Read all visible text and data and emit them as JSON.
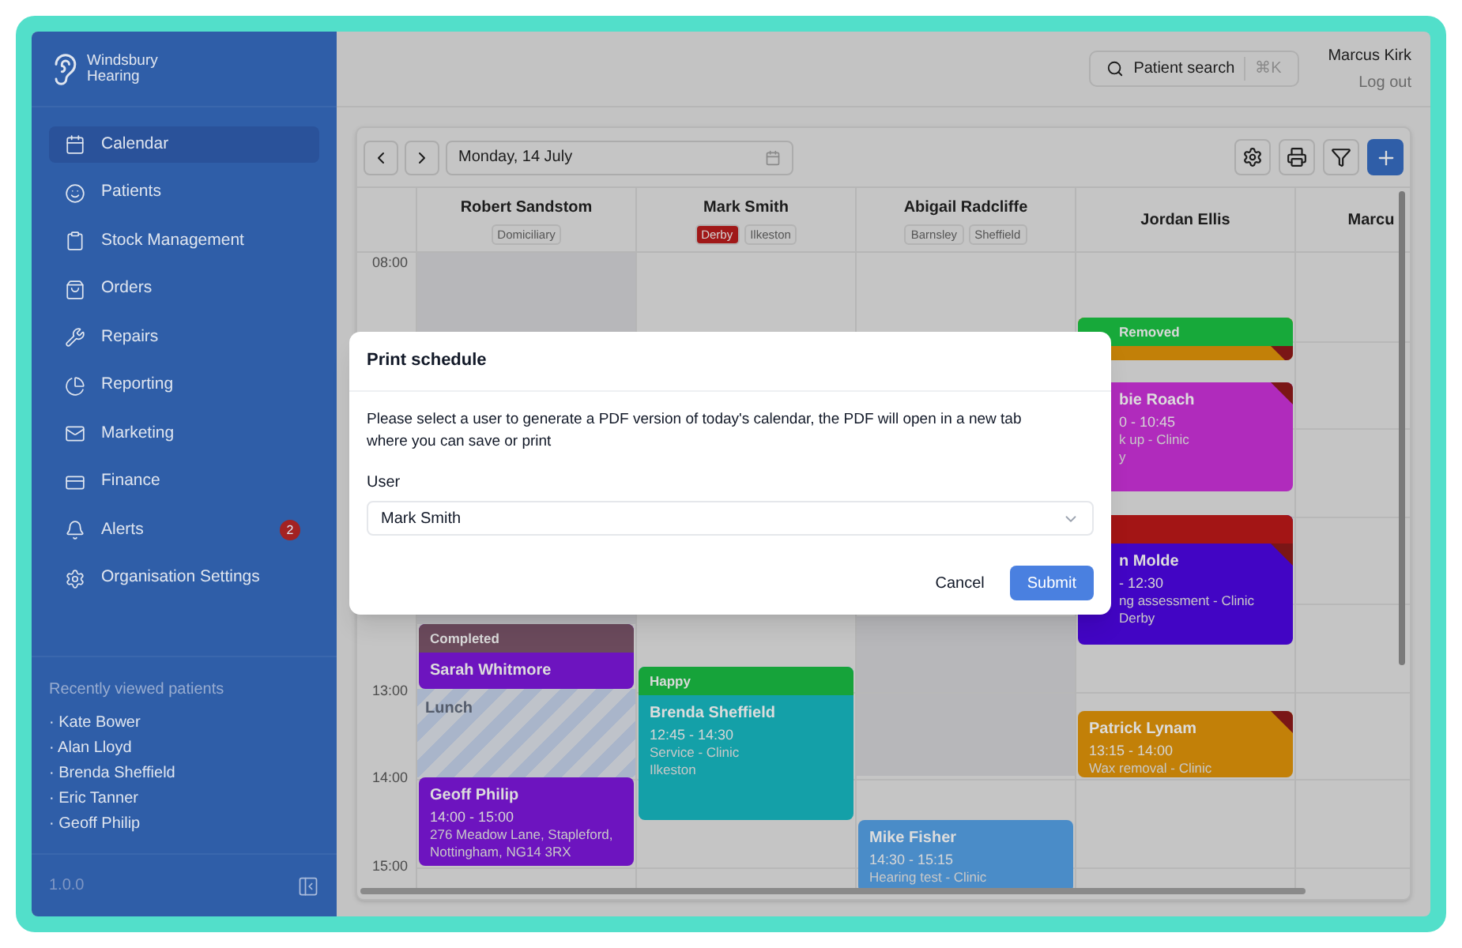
{
  "brand": {
    "name": "Windsbury Hearing"
  },
  "sidebar": {
    "items": [
      {
        "label": "Calendar",
        "selected": true
      },
      {
        "label": "Patients",
        "selected": false
      },
      {
        "label": "Stock Management",
        "selected": false
      },
      {
        "label": "Orders",
        "selected": false
      },
      {
        "label": "Repairs",
        "selected": false
      },
      {
        "label": "Reporting",
        "selected": false
      },
      {
        "label": "Marketing",
        "selected": false
      },
      {
        "label": "Finance",
        "selected": false
      },
      {
        "label": "Alerts",
        "selected": false,
        "badge": "2"
      },
      {
        "label": "Organisation Settings",
        "selected": false
      }
    ],
    "recent": {
      "title": "Recently viewed patients",
      "items": [
        "· Kate Bower",
        "· Alan Lloyd",
        "· Brenda Sheffield",
        "· Eric Tanner",
        "· Geoff Philip"
      ]
    },
    "version": "1.0.0"
  },
  "header": {
    "search": {
      "label": "Patient search",
      "shortcut": "⌘K"
    },
    "user": {
      "name": "Marcus Kirk",
      "logout": "Log out"
    }
  },
  "calendar": {
    "date": "Monday, 14 July",
    "hours": [
      "08:00",
      "13:00",
      "14:00",
      "15:00"
    ],
    "columns": [
      {
        "name": "Robert Sandstom",
        "tags": [
          {
            "label": "Domiciliary",
            "color": "#c4c4c4"
          }
        ],
        "events": [
          {
            "kind": "appointment",
            "color": "#6d14bf",
            "status": {
              "label": "Completed",
              "color": "#6b4a5c"
            },
            "flagged": false,
            "lines": [
              "Sarah Whitmore"
            ]
          },
          {
            "kind": "break",
            "lines": [
              "Lunch"
            ]
          },
          {
            "kind": "appointment",
            "color": "#6d14bf",
            "flagged": false,
            "lines": [
              "Geoff Philip",
              "14:00 - 15:00",
              "276 Meadow Lane, Stapleford, Nottingham, NG14 3RX"
            ]
          }
        ]
      },
      {
        "name": "Mark Smith",
        "tags": [
          {
            "label": "Derby",
            "color": "#a01818"
          },
          {
            "label": "Ilkeston",
            "color": "#c4c4c4"
          }
        ],
        "events": [
          {
            "kind": "appointment",
            "color": "#14a0a8",
            "status": {
              "label": "Happy",
              "color": "#16a33a"
            },
            "flagged": false,
            "lines": [
              "Brenda Sheffield",
              "12:45 - 14:30",
              "Service - Clinic",
              "Ilkeston"
            ]
          }
        ]
      },
      {
        "name": "Abigail Radcliffe",
        "tags": [
          {
            "label": "Barnsley",
            "color": "#c4c4c4"
          },
          {
            "label": "Sheffield",
            "color": "#c4c4c4"
          }
        ],
        "events": [
          {
            "kind": "appointment",
            "color": "#4a8cc8",
            "flagged": false,
            "lines": [
              "Mike Fisher",
              "14:30 - 15:15",
              "Hearing test - Clinic"
            ]
          }
        ]
      },
      {
        "name": "Jordan Ellis",
        "events": [
          {
            "kind": "appointment",
            "color": "#c28008",
            "status": {
              "label": "Removed",
              "color": "#17a93a"
            },
            "flagged": true
          },
          {
            "kind": "appointment",
            "color": "#b02bbc",
            "flagged": true,
            "lines": [
              "bie Roach",
              "0 - 10:45",
              "k up - Clinic",
              "y"
            ]
          },
          {
            "kind": "appointment",
            "color": "#4205c4",
            "status": {
              "color": "#a31515"
            },
            "flagged": true,
            "lines": [
              "n Molde",
              "- 12:30",
              "ng assessment - Clinic",
              "Derby"
            ]
          },
          {
            "kind": "appointment",
            "color": "#c28008",
            "flagged": true,
            "lines": [
              "Patrick Lynam",
              "13:15 - 14:00",
              "Wax removal - Clinic"
            ]
          }
        ]
      },
      {
        "name": "Marcu"
      }
    ]
  },
  "dialog": {
    "title": "Print schedule",
    "message": "Please select a user to generate a PDF version of today's calendar, the PDF will open in a new tab where you can save or print",
    "field_label": "User",
    "value": "Mark Smith",
    "buttons": [
      {
        "label": "Cancel",
        "kind": "plain"
      },
      {
        "label": "Submit",
        "kind": "primary"
      }
    ]
  }
}
